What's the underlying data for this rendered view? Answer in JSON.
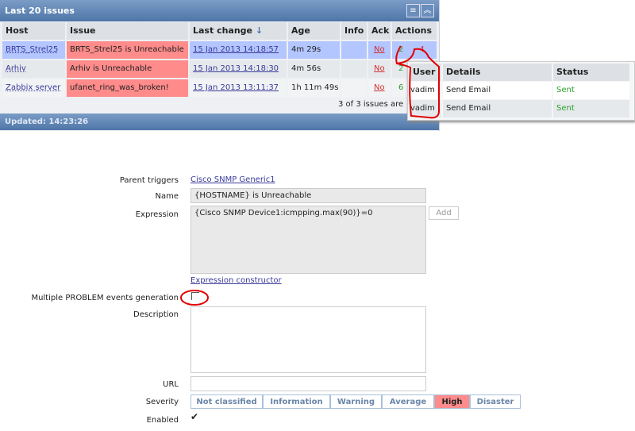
{
  "widget": {
    "title": "Last 20 issues",
    "updated": "Updated: 14:23:26",
    "footer": "3 of 3 issues are",
    "columns": [
      "Host",
      "Issue",
      "Last change",
      "Age",
      "Info",
      "Ack",
      "Actions"
    ],
    "rows": [
      {
        "host": "BRTS_Strel25",
        "issue": "BRTS_Strel25 is Unreachable",
        "last_change": "15 Jan 2013 14:18:57",
        "age": "4m 29s",
        "ack": "No",
        "actions_ok": "2",
        "actions_fail": "4"
      },
      {
        "host": "Arhiv",
        "issue": "Arhiv is Unreachable",
        "last_change": "15 Jan 2013 14:18:30",
        "age": "4m 56s",
        "ack": "No",
        "actions_ok": "2"
      },
      {
        "host": "Zabbix server",
        "issue": "ufanet_ring_was_broken!",
        "last_change": "15 Jan 2013 13:11:37",
        "age": "1h 11m 49s",
        "ack": "No",
        "actions_ok": "6"
      }
    ]
  },
  "popup": {
    "columns": [
      "User",
      "Details",
      "Status"
    ],
    "rows": [
      {
        "user": "vadim",
        "details": "Send Email",
        "status": "Sent"
      },
      {
        "user": "vadim",
        "details": "Send Email",
        "status": "Sent"
      }
    ]
  },
  "form": {
    "parent_label": "Parent triggers",
    "parent_value": "Cisco SNMP Generic1",
    "name_label": "Name",
    "name_value": "{HOSTNAME} is Unreachable",
    "expr_label": "Expression",
    "expr_value": "{Cisco SNMP Device1:icmpping.max(90)}=0",
    "add": "Add",
    "constructor": "Expression constructor",
    "multiple_label": "Multiple PROBLEM events generation",
    "desc_label": "Description",
    "url_label": "URL",
    "severity_label": "Severity",
    "enabled_label": "Enabled",
    "severities": [
      "Not classified",
      "Information",
      "Warning",
      "Average",
      "High",
      "Disaster"
    ],
    "selected_severity": "High"
  },
  "colors": {
    "high": "#ff8b8b",
    "annotation": "#e00000"
  }
}
